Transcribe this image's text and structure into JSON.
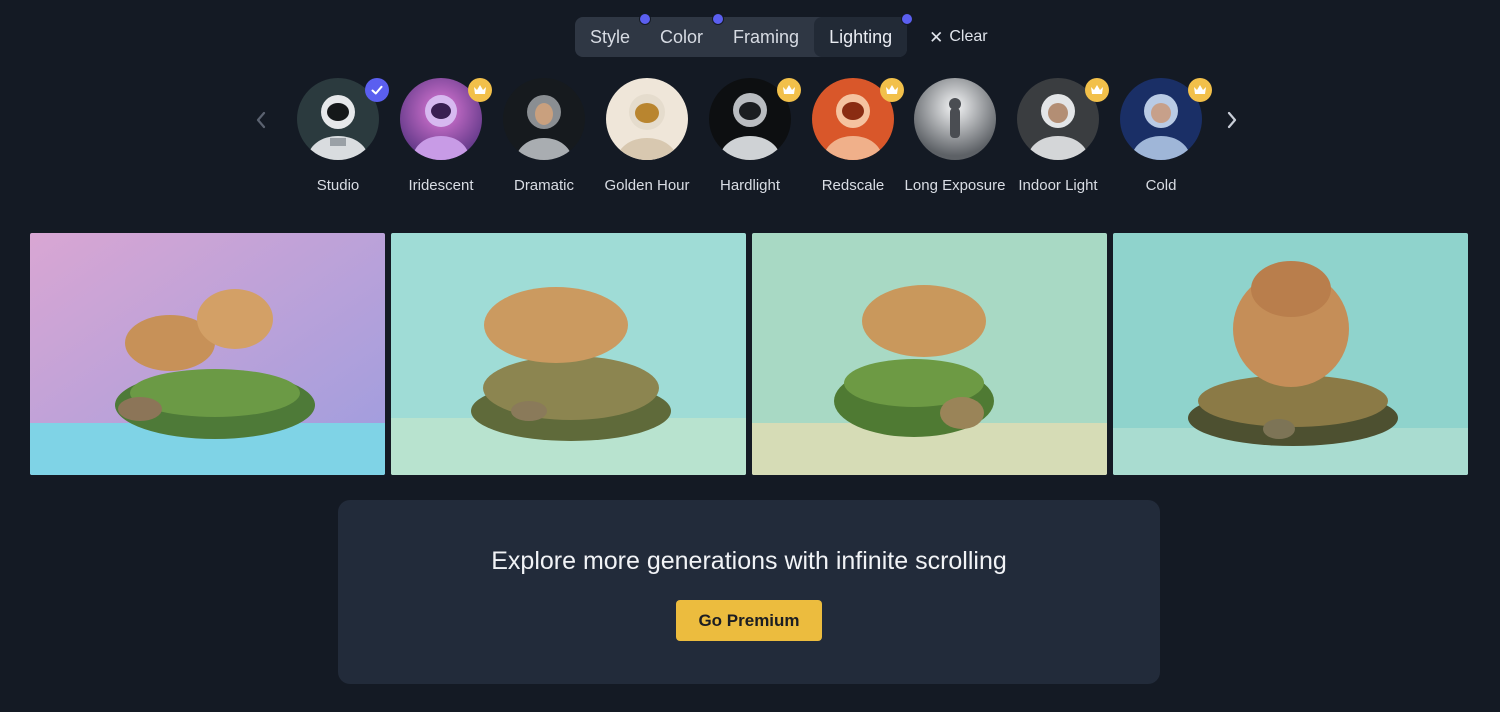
{
  "filters": {
    "tabs": [
      {
        "label": "Style",
        "has_dot": true
      },
      {
        "label": "Color",
        "has_dot": true
      },
      {
        "label": "Framing",
        "has_dot": false
      },
      {
        "label": "Lighting",
        "has_dot": true
      }
    ],
    "active_tab": "Lighting",
    "clear_label": "Clear"
  },
  "styles": {
    "items": [
      {
        "label": "Studio",
        "badge": "check"
      },
      {
        "label": "Iridescent",
        "badge": "crown"
      },
      {
        "label": "Dramatic",
        "badge": "none"
      },
      {
        "label": "Golden Hour",
        "badge": "none"
      },
      {
        "label": "Hardlight",
        "badge": "crown"
      },
      {
        "label": "Redscale",
        "badge": "crown"
      },
      {
        "label": "Long Exposure",
        "badge": "none"
      },
      {
        "label": "Indoor Light",
        "badge": "crown"
      },
      {
        "label": "Cold",
        "badge": "crown"
      }
    ],
    "selected": "Studio",
    "icons": [
      "chevron-left-icon",
      "chevron-right-icon",
      "checkmark-icon",
      "crown-icon"
    ]
  },
  "images": {
    "count": 4,
    "subject": "capybara on turtle"
  },
  "premium": {
    "title": "Explore more generations with infinite scrolling",
    "button_label": "Go Premium"
  },
  "colors": {
    "background": "#141a24",
    "accent": "#5b5ff0",
    "premium": "#ecbc3e"
  }
}
